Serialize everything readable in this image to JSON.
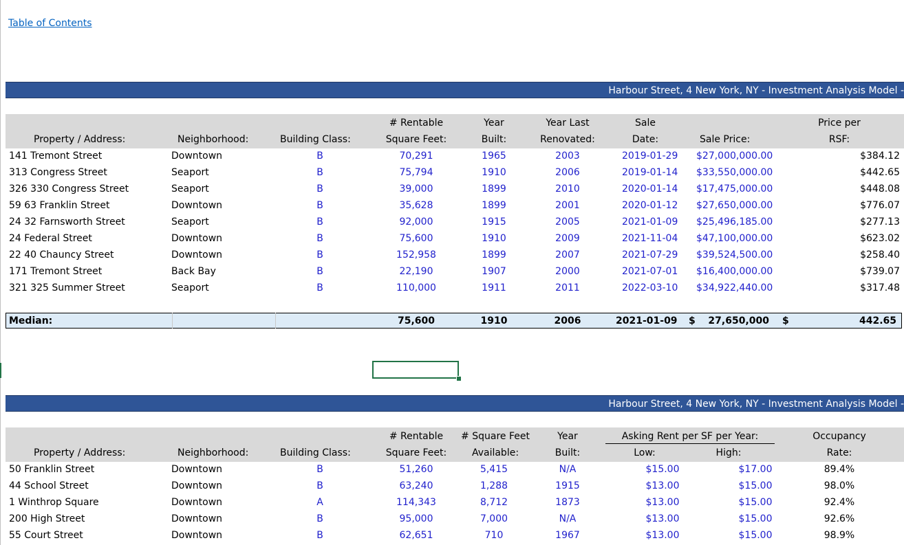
{
  "toc_link": "Table of Contents",
  "banner1": {
    "title": "Harbour Street, 4 New York, NY - Investment Analysis Model -"
  },
  "banner2": {
    "title": "Harbour Street, 4 New York, NY - Investment Analysis Model -"
  },
  "table1": {
    "headers": {
      "property": "Property / Address:",
      "neighborhood": "Neighborhood:",
      "building_class": "Building Class:",
      "rsf_top": "# Rentable",
      "rsf_bottom": "Square Feet:",
      "year_built_top": "Year",
      "year_built_bottom": "Built:",
      "year_renov_top": "Year Last",
      "year_renov_bottom": "Renovated:",
      "sale_date_top": "Sale",
      "sale_date_bottom": "Date:",
      "sale_price": "Sale Price:",
      "price_rsf_top": "Price per",
      "price_rsf_bottom": "RSF:"
    },
    "rows": [
      {
        "property": "141 Tremont Street",
        "neighborhood": "Downtown",
        "class": "B",
        "rsf": "70,291",
        "built": "1965",
        "renovated": "2003",
        "date": "2019-01-29",
        "price": "$27,000,000.00",
        "per_rsf": "$384.12"
      },
      {
        "property": "313 Congress Street",
        "neighborhood": "Seaport",
        "class": "B",
        "rsf": "75,794",
        "built": "1910",
        "renovated": "2006",
        "date": "2019-01-14",
        "price": "$33,550,000.00",
        "per_rsf": "$442.65"
      },
      {
        "property": "326 330 Congress Street",
        "neighborhood": "Seaport",
        "class": "B",
        "rsf": "39,000",
        "built": "1899",
        "renovated": "2010",
        "date": "2020-01-14",
        "price": "$17,475,000.00",
        "per_rsf": "$448.08"
      },
      {
        "property": "59 63 Franklin Street",
        "neighborhood": "Downtown",
        "class": "B",
        "rsf": "35,628",
        "built": "1899",
        "renovated": "2001",
        "date": "2020-01-12",
        "price": "$27,650,000.00",
        "per_rsf": "$776.07"
      },
      {
        "property": "24 32 Farnsworth Street",
        "neighborhood": "Seaport",
        "class": "B",
        "rsf": "92,000",
        "built": "1915",
        "renovated": "2005",
        "date": "2021-01-09",
        "price": "$25,496,185.00",
        "per_rsf": "$277.13"
      },
      {
        "property": "24 Federal Street",
        "neighborhood": "Downtown",
        "class": "B",
        "rsf": "75,600",
        "built": "1910",
        "renovated": "2009",
        "date": "2021-11-04",
        "price": "$47,100,000.00",
        "per_rsf": "$623.02"
      },
      {
        "property": "22 40 Chauncy Street",
        "neighborhood": "Downtown",
        "class": "B",
        "rsf": "152,958",
        "built": "1899",
        "renovated": "2007",
        "date": "2021-07-29",
        "price": "$39,524,500.00",
        "per_rsf": "$258.40"
      },
      {
        "property": "171 Tremont Street",
        "neighborhood": "Back Bay",
        "class": "B",
        "rsf": "22,190",
        "built": "1907",
        "renovated": "2000",
        "date": "2021-07-01",
        "price": "$16,400,000.00",
        "per_rsf": "$739.07"
      },
      {
        "property": "321 325 Summer Street",
        "neighborhood": "Seaport",
        "class": "B",
        "rsf": "110,000",
        "built": "1911",
        "renovated": "2011",
        "date": "2022-03-10",
        "price": "$34,922,440.00",
        "per_rsf": "$317.48"
      }
    ],
    "median": {
      "label": "Median:",
      "rsf": "75,600",
      "built": "1910",
      "renovated": "2006",
      "date": "2021-01-09",
      "price_symbol": "$",
      "price": "27,650,000",
      "per_rsf_symbol": "$",
      "per_rsf": "442.65"
    }
  },
  "table2": {
    "headers": {
      "property": "Property / Address:",
      "neighborhood": "Neighborhood:",
      "building_class": "Building Class:",
      "rsf_top": "# Rentable",
      "rsf_bottom": "Square Feet:",
      "avail_top": "# Square Feet",
      "avail_bottom": "Available:",
      "year_built_top": "Year",
      "year_built_bottom": "Built:",
      "asking_rent": "Asking Rent per SF per Year:",
      "low": "Low:",
      "high": "High:",
      "occupancy_top": "Occupancy",
      "occupancy_bottom": "Rate:"
    },
    "rows": [
      {
        "property": "50 Franklin Street",
        "neighborhood": "Downtown",
        "class": "B",
        "rsf": "51,260",
        "avail": "5,415",
        "built": "N/A",
        "low": "$15.00",
        "high": "$17.00",
        "occ": "89.4%"
      },
      {
        "property": "44 School Street",
        "neighborhood": "Downtown",
        "class": "B",
        "rsf": "63,240",
        "avail": "1,288",
        "built": "1915",
        "low": "$13.00",
        "high": "$15.00",
        "occ": "98.0%"
      },
      {
        "property": "1 Winthrop Square",
        "neighborhood": "Downtown",
        "class": "A",
        "rsf": "114,343",
        "avail": "8,712",
        "built": "1873",
        "low": "$13.00",
        "high": "$15.00",
        "occ": "92.4%"
      },
      {
        "property": "200 High Street",
        "neighborhood": "Downtown",
        "class": "B",
        "rsf": "95,000",
        "avail": "7,000",
        "built": "N/A",
        "low": "$13.00",
        "high": "$15.00",
        "occ": "92.6%"
      },
      {
        "property": "55 Court Street",
        "neighborhood": "Downtown",
        "class": "B",
        "rsf": "62,651",
        "avail": "710",
        "built": "1967",
        "low": "$13.00",
        "high": "$15.00",
        "occ": "98.9%"
      }
    ]
  },
  "colors": {
    "banner": "#2f5597",
    "header_bg": "#d9d9d9",
    "median_bg": "#ddebf7",
    "input_blue": "#1f1fcc",
    "link": "#0563c1",
    "selection": "#217346"
  }
}
